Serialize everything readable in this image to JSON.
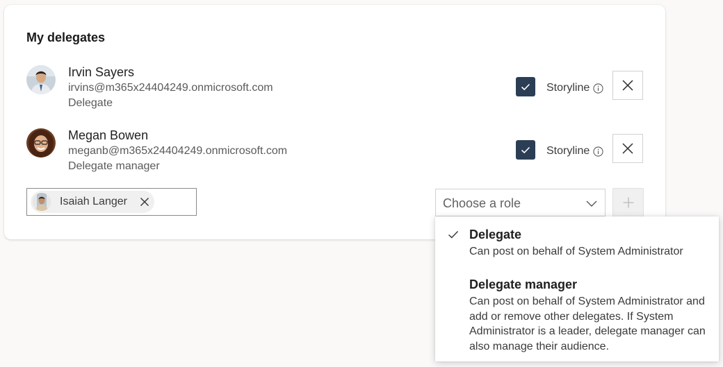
{
  "section_title": "My delegates",
  "delegates": [
    {
      "name": "Irvin Sayers",
      "email": "irvins@m365x24404249.onmicrosoft.com",
      "role": "Delegate",
      "storyline_checked": true,
      "storyline_label": "Storyline"
    },
    {
      "name": "Megan Bowen",
      "email": "meganb@m365x24404249.onmicrosoft.com",
      "role": "Delegate manager",
      "storyline_checked": true,
      "storyline_label": "Storyline"
    }
  ],
  "people_picker": {
    "selected_name": "Isaiah Langer"
  },
  "role_select": {
    "placeholder": "Choose a role",
    "open": true
  },
  "role_options": [
    {
      "title": "Delegate",
      "description": "Can post on behalf of System Administrator",
      "selected": true
    },
    {
      "title": "Delegate manager",
      "description": "Can post on behalf of System Administrator and add or remove other delegates. If System Administrator is a leader, delegate manager can also manage their audience.",
      "selected": false
    }
  ],
  "icons": {
    "remove": "close-icon",
    "info": "info-icon",
    "add": "plus-icon",
    "chevron": "chevron-down-icon",
    "check": "checkmark-icon"
  },
  "colors": {
    "checkbox_fill": "#2b3e55",
    "page_bg": "#faf9f8",
    "card_bg": "#ffffff"
  }
}
